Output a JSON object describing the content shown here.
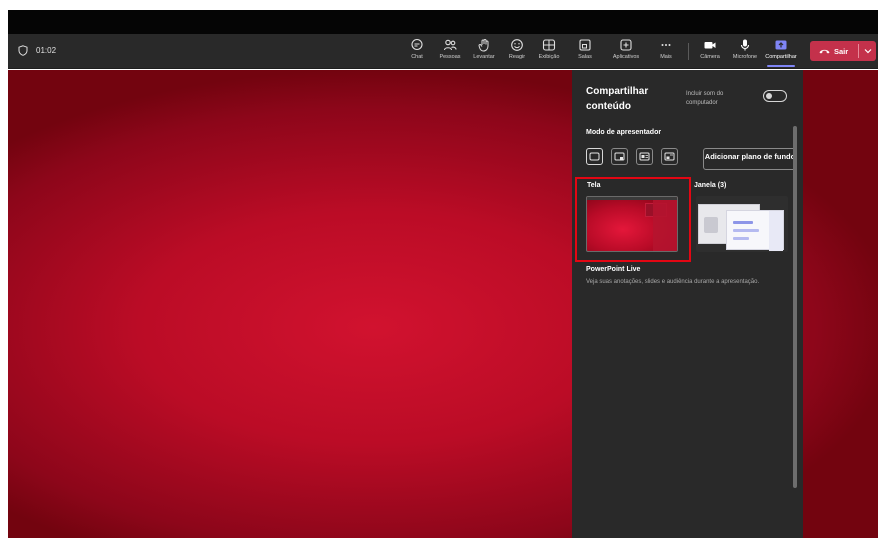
{
  "meeting": {
    "timer": "01:02"
  },
  "toolbar": {
    "items": [
      {
        "label": "Chat",
        "icon": "chat-icon"
      },
      {
        "label": "Pessoas",
        "icon": "people-icon"
      },
      {
        "label": "Levantar",
        "icon": "raise-hand-icon"
      },
      {
        "label": "Reagir",
        "icon": "react-icon"
      },
      {
        "label": "Exibição",
        "icon": "view-icon"
      },
      {
        "label": "Salas",
        "icon": "rooms-icon"
      },
      {
        "label": "Aplicativos",
        "icon": "apps-icon"
      },
      {
        "label": "Mais",
        "icon": "more-icon"
      },
      {
        "label": "Câmera",
        "icon": "camera-icon"
      },
      {
        "label": "Microfone",
        "icon": "mic-icon"
      },
      {
        "label": "Compartilhar",
        "icon": "share-icon"
      }
    ],
    "active": "Compartilhar",
    "leave_label": "Sair"
  },
  "share_panel": {
    "title": "Compartilhar conteúdo",
    "include_sound": "Incluir som do computador",
    "include_sound_on": false,
    "presenter_mode_title": "Modo de apresentador",
    "presenter_modes": [
      "content-only-icon",
      "standout-icon",
      "side-by-side-icon",
      "reporter-icon"
    ],
    "background_button": "Adicionar plano de fundo",
    "screen_label": "Tela",
    "window_label": "Janela (3)",
    "ppt_title": "PowerPoint Live",
    "ppt_desc": "Veja suas anotações, slides e audiência durante a apresentação."
  },
  "colors": {
    "toolbar_bg": "#292929",
    "panel_bg": "#292929",
    "leave_button": "#c4314b",
    "active_accent": "#7f85f5",
    "stage_red": "#bb0c26",
    "highlight_frame": "#e30613"
  }
}
